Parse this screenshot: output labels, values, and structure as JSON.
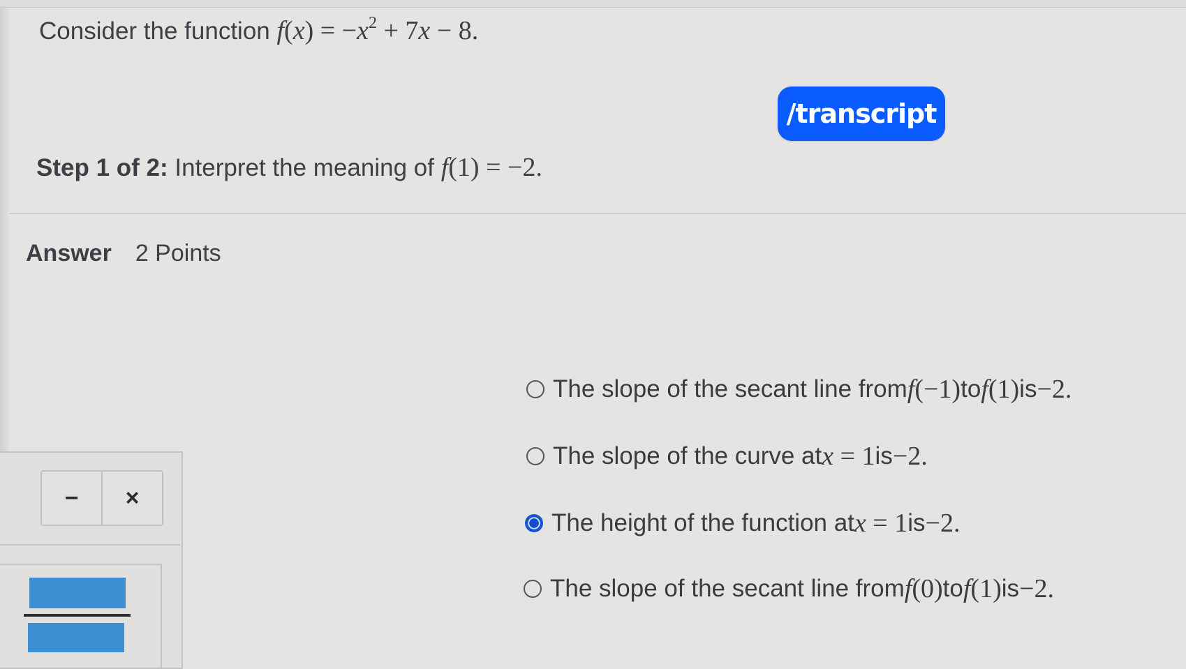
{
  "question": {
    "prefix": "Consider the function ",
    "math": {
      "fn": "f",
      "open": "(",
      "var": "x",
      "close": ")",
      "eq": " = −",
      "x2": "x",
      "exp": "2",
      "rest1": " + 7",
      "x3": "x",
      "rest2": " − 8."
    }
  },
  "transcript_button": {
    "label": "/transcript"
  },
  "step": {
    "bold": "Step 1 of 2:",
    "text": " Interpret the meaning of ",
    "math_fn": "f",
    "math_rest": "(1) = −2."
  },
  "answer": {
    "label": "Answer",
    "points": "2 Points"
  },
  "options": [
    {
      "pre": "The slope of the secant line from ",
      "m1f": "f",
      "m1r": "(−1)",
      "mid": " to ",
      "m2f": "f",
      "m2r": "(1)",
      "post": " is ",
      "val": "−2.",
      "selected": false
    },
    {
      "pre": "The slope of the curve at ",
      "m1f": "x",
      "m1r": " = 1",
      "post": " is ",
      "val": "−2.",
      "selected": false
    },
    {
      "pre": "The height of the function at ",
      "m1f": "x",
      "m1r": " = 1",
      "post": " is ",
      "val": "−2.",
      "selected": true
    },
    {
      "pre": "The slope of the secant line from ",
      "m1f": "f",
      "m1r": "(0)",
      "mid": " to ",
      "m2f": "f",
      "m2r": "(1)",
      "post": " is ",
      "val": "−2.",
      "selected": false
    }
  ],
  "toolbar": {
    "minus_label": "−",
    "close_label": "×"
  },
  "colors": {
    "accent": "#0b5cff",
    "selected_radio": "#1456d8",
    "fraction_tile": "#3d8fd1",
    "background": "#e6e4e3"
  }
}
